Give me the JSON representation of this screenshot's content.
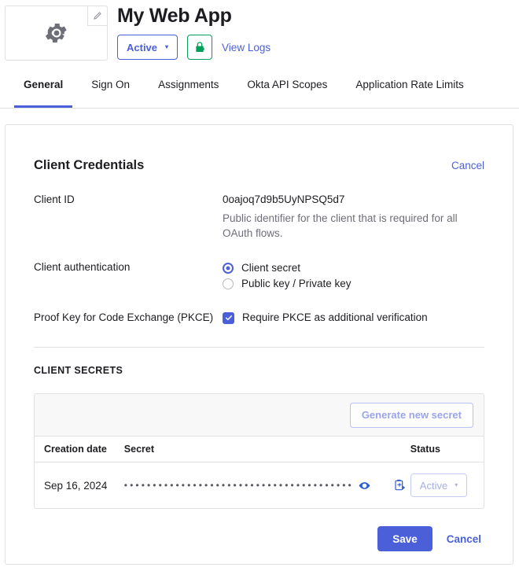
{
  "header": {
    "app_title": "My Web App",
    "logo_icon": "gear-icon",
    "edit_badge_icon": "pencil-icon",
    "status_label": "Active",
    "status_caret": "▾",
    "lock_button_icon": "lock-key-icon",
    "view_logs_label": "View Logs",
    "accent_blue": "#4b60d8",
    "accent_green": "#00a05a"
  },
  "tabs": [
    {
      "label": "General",
      "active": true
    },
    {
      "label": "Sign On",
      "active": false
    },
    {
      "label": "Assignments",
      "active": false
    },
    {
      "label": "Okta API Scopes",
      "active": false
    },
    {
      "label": "Application Rate Limits",
      "active": false
    }
  ],
  "card": {
    "title": "Client Credentials",
    "cancel_label": "Cancel",
    "client_id": {
      "label": "Client ID",
      "value": "0oajoq7d9b5UyNPSQ5d7",
      "help": "Public identifier for the client that is required for all OAuth flows."
    },
    "client_authentication": {
      "label": "Client authentication",
      "options": [
        {
          "label": "Client secret",
          "selected": true
        },
        {
          "label": "Public key / Private key",
          "selected": false
        }
      ]
    },
    "pkce": {
      "label": "Proof Key for Code Exchange (PKCE)",
      "checkbox_label": "Require PKCE as additional verification",
      "checked": true,
      "check_icon": "checkmark-icon"
    },
    "secrets_section": {
      "title": "CLIENT SECRETS",
      "generate_button": "Generate new secret",
      "columns": [
        "Creation date",
        "Secret",
        "Status"
      ],
      "rows": [
        {
          "creation_date": "Sep 16, 2024",
          "secret_masked": "••••••••••••••••••••••••••••••••••••••••••••••••",
          "reveal_icon": "eye-icon",
          "copy_icon": "clipboard-copy-icon",
          "status": "Active",
          "status_caret": "▾"
        }
      ]
    },
    "footer": {
      "save_label": "Save",
      "cancel_label": "Cancel"
    }
  }
}
